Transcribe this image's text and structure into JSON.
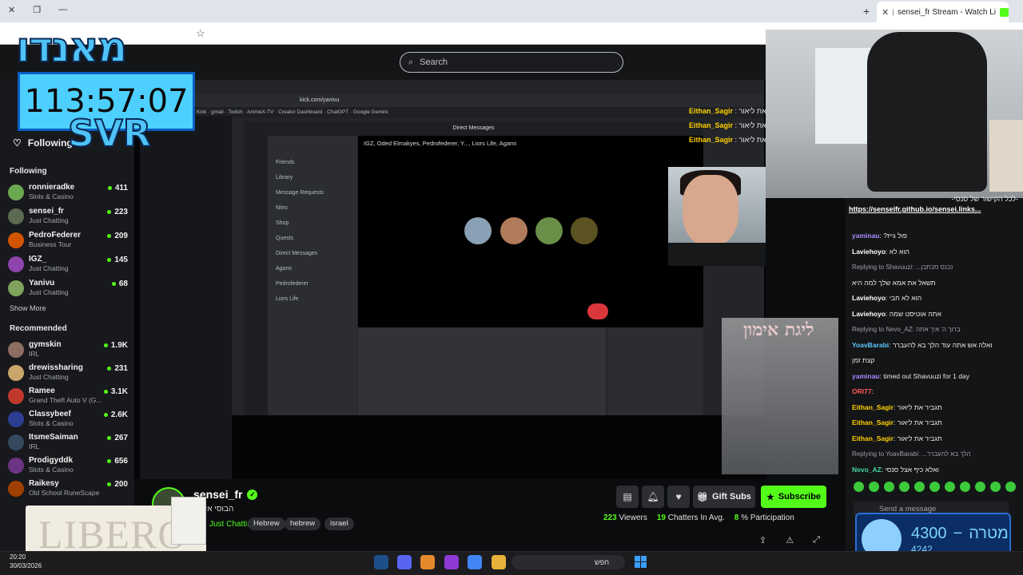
{
  "browser": {
    "tab_title": "sensei_fr Stream - Watch Li",
    "tab_close": "✕",
    "new_tab": "+"
  },
  "kick": {
    "search_placeholder": "Search",
    "sidebar": {
      "following_top": "Following",
      "following_title": "Following",
      "recommended_title": "Recommended",
      "show_more": "Show More",
      "following": [
        {
          "name": "ronnieradke",
          "category": "Slots & Casino",
          "viewers": "411",
          "color": "#6aa84f"
        },
        {
          "name": "sensei_fr",
          "category": "Just Chatting",
          "viewers": "223",
          "color": "#5a6b52"
        },
        {
          "name": "PedroFederer",
          "category": "Business Tour",
          "viewers": "209",
          "color": "#d35400"
        },
        {
          "name": "IGZ_",
          "category": "Just Chatting",
          "viewers": "145",
          "color": "#8e44ad"
        },
        {
          "name": "Yanivu",
          "category": "Just Chatting",
          "viewers": "68",
          "color": "#7fa35a"
        }
      ],
      "recommended": [
        {
          "name": "gymskin",
          "category": "IRL",
          "viewers": "1.9K",
          "color": "#8d6e63"
        },
        {
          "name": "drewissharing",
          "category": "Just Chatting",
          "viewers": "231",
          "color": "#c9a66b"
        },
        {
          "name": "Ramee",
          "category": "Grand Theft Auto V (G...",
          "viewers": "3.1K",
          "color": "#c0392b"
        },
        {
          "name": "Classybeef",
          "category": "Slots & Casino",
          "viewers": "2.6K",
          "color": "#2c3e91"
        },
        {
          "name": "ItsmeSaiman",
          "category": "IRL",
          "viewers": "267",
          "color": "#34495e"
        },
        {
          "name": "Prodigyddk",
          "category": "Slots & Casino",
          "viewers": "656",
          "color": "#6c3483"
        },
        {
          "name": "Raikesy",
          "category": "Old School RuneScape",
          "viewers": "200",
          "color": "#a04000"
        }
      ]
    },
    "streamer": {
      "name": "sensei_fr",
      "title": "הבוסי איז בי",
      "category": "Just Chatting",
      "tags": [
        "Hebrew",
        "hebrew",
        "israel"
      ],
      "viewers": "223",
      "viewers_label": "Viewers",
      "chatters": "19",
      "chatters_label": "Chatters In Avg.",
      "participation": "8",
      "participation_label": "% Participation",
      "gift_label": "Gift Subs",
      "subscribe_label": "Subscribe"
    }
  },
  "chat": {
    "pinned_title": "-לכל הקישור של סנסי-",
    "pinned_link": "https://senseifr.github.io/sensei.links...",
    "input_placeholder": "Send a message",
    "messages": [
      {
        "user": "yaminau",
        "text": "?פול גייז",
        "color": "#a98bff",
        "reply": ""
      },
      {
        "user": "Laviehoyo",
        "text": "הוא לא",
        "color": "#ffffff",
        "reply": ""
      },
      {
        "user": "",
        "text": "",
        "color": "#9c9ea3",
        "reply": "Replying to Shavuuzi: ...נכנס מכתבן"
      },
      {
        "user": "",
        "text": "תשאל את אמא שלך למה היא",
        "color": "#ffffff",
        "reply": ""
      },
      {
        "user": "Laviehoyo",
        "text": "הוא לא חבי",
        "color": "#ffffff",
        "reply": ""
      },
      {
        "user": "Laviehoyo",
        "text": "אתה אוטיסט שמה",
        "color": "#ffffff",
        "reply": ""
      },
      {
        "user": "",
        "text": "",
        "color": "#9c9ea3",
        "reply": "Replying to Nevo_AZ: ברוך ה' איך אתה"
      },
      {
        "user": "YoavBarabi",
        "text": "ואלה אש אתה עוד הלך בא להעברר",
        "color": "#5ec8ff",
        "reply": ""
      },
      {
        "user": "",
        "text": "קצת זמן",
        "color": "#ffffff",
        "reply": ""
      },
      {
        "user": "yaminau",
        "text": "timed out Shavuuzi for 1 day",
        "color": "#a98bff",
        "reply": ""
      },
      {
        "user": "ORI77",
        "text": "",
        "color": "#ff5c5c",
        "reply": ""
      },
      {
        "user": "Eithan_Sagir",
        "text": "תגביר את ליאור",
        "color": "#ffd200",
        "reply": ""
      },
      {
        "user": "Eithan_Sagir",
        "text": "תגביר את ליאור",
        "color": "#ffd200",
        "reply": ""
      },
      {
        "user": "Eithan_Sagir",
        "text": "תגביר את ליאור",
        "color": "#ffd200",
        "reply": ""
      },
      {
        "user": "",
        "text": "",
        "color": "#9c9ea3",
        "reply": "Replying to YoavBarabi: ...הלך בא להעברר"
      },
      {
        "user": "Nevo_AZ",
        "text": "ואלא כיף אצל סנסי",
        "color": "#45d9a0",
        "reply": ""
      }
    ]
  },
  "overlay": {
    "timer": "113:57:07",
    "logo": "מאנדו",
    "svr": "SVR",
    "libero": "LIBERO",
    "goal_label": "מטרה",
    "goal_target": "4300",
    "goal_current": "4242",
    "chat_overlay": [
      {
        "user": "Eithan_Sagir",
        "text": "תגביר את ליאור"
      },
      {
        "user": "Eithan_Sagir",
        "text": "תגביר את ליאור"
      },
      {
        "user": "Eithan_Sagir",
        "text": "תגביר את ליאור"
      }
    ],
    "poster_title": "ליגת אימון"
  },
  "inner": {
    "url": "kick.com/yanivu",
    "bookmarks": "Kick · gmail · Twitch · AnimeX-TV · Creator Dashboard · ChatGPT · Google Gemini",
    "dm_bar": "Direct Messages",
    "dm_header": "IGZ, Oded Elmakyes, Pedrofederer, Y..., Liors Life, Agami",
    "dm_items": [
      "Friends",
      "Library",
      "Message Requests",
      "Nitro",
      "Shop",
      "Quests",
      "Direct Messages",
      "Agami",
      "Pedrofederer",
      "Liors Life"
    ]
  },
  "taskbar": {
    "time": "20:20",
    "date": "30/03/2026",
    "search": "חפש"
  }
}
